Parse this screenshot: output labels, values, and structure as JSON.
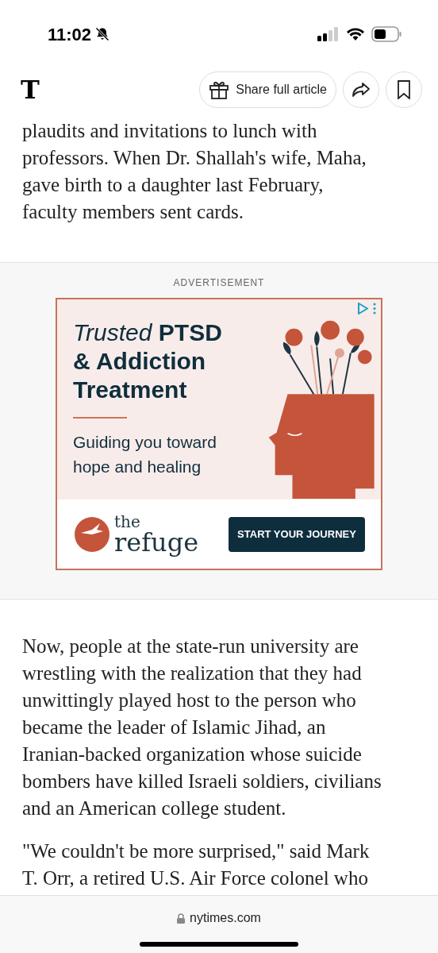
{
  "status_bar": {
    "time": "11:02",
    "silent": true
  },
  "toolbar": {
    "logo": "T",
    "share_button": "Share full article"
  },
  "article_top": {
    "lines": [
      "plaudits and invitations to lunch with",
      "professors. When Dr. Shallah's wife, Maha,",
      "gave birth to a daughter last February,",
      "faculty members sent cards."
    ]
  },
  "advertisement": {
    "label": "ADVERTISEMENT",
    "headline_italic": "Trusted",
    "headline_lines": [
      "PTSD",
      "& Addiction",
      "Treatment"
    ],
    "subline_lines": [
      "Guiding you toward",
      "hope and healing"
    ],
    "brand_small": "the",
    "brand_large": "refuge",
    "cta": "START YOUR JOURNEY"
  },
  "article_bottom": [
    {
      "lines": [
        "Now, people at the state-run university are",
        "wrestling with the realization that they had",
        "unwittingly played host to the person who",
        "became the leader of Islamic Jihad, an",
        "Iranian-backed organization whose suicide",
        "bombers have killed Israeli soldiers, civilians",
        "and an American college student."
      ]
    },
    {
      "lines": [
        "\"We couldn't be more surprised,\" said Mark",
        "T. Orr, a retired U.S. Air Force colonel who"
      ]
    }
  ],
  "address_bar": {
    "url": "nytimes.com"
  }
}
